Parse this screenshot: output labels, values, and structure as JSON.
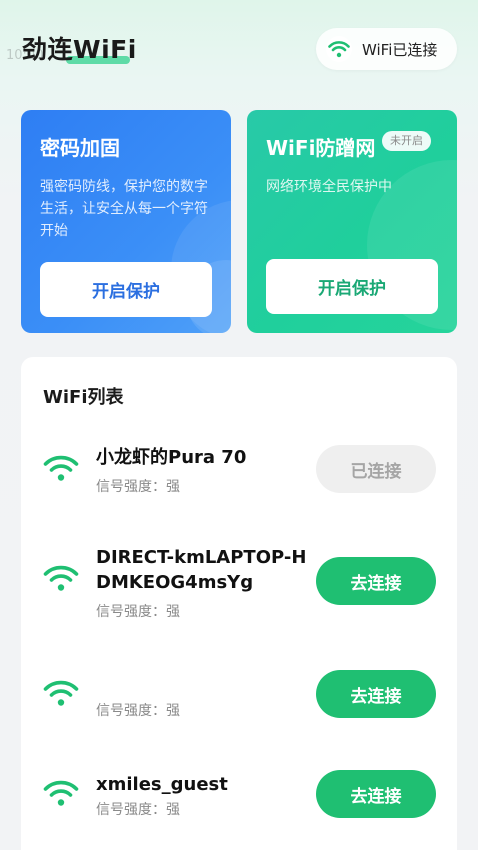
{
  "status_bar": {
    "time": "10:00"
  },
  "header": {
    "app_title": "劲连WiFi",
    "connection_status": "WiFi已连接"
  },
  "cards": {
    "password": {
      "title": "密码加固",
      "description": "强密码防线，保护您的数字生活，让安全从每一个字符开始",
      "button": "开启保护"
    },
    "antileech": {
      "title": "WiFi防蹭网",
      "badge": "未开启",
      "description": "网络环境全民保护中",
      "button": "开启保护"
    }
  },
  "wifi_list": {
    "title": "WiFi列表",
    "networks": [
      {
        "name": "小龙虾的Pura 70",
        "strength": "信号强度：强",
        "action": "已连接"
      },
      {
        "name": "DIRECT-kmLAPTOP-HDMKEOG4msYg",
        "strength": "信号强度：强",
        "action": "去连接"
      },
      {
        "name": "",
        "strength": "信号强度：强",
        "action": "去连接"
      },
      {
        "name": "xmiles_guest",
        "strength": "信号强度：强",
        "action": "去连接"
      }
    ]
  },
  "colors": {
    "brand_green": "#1fbf72",
    "card_blue": "#2e7ef3",
    "card_teal": "#20cf9c"
  },
  "icons": {
    "wifi": "wifi-icon"
  }
}
